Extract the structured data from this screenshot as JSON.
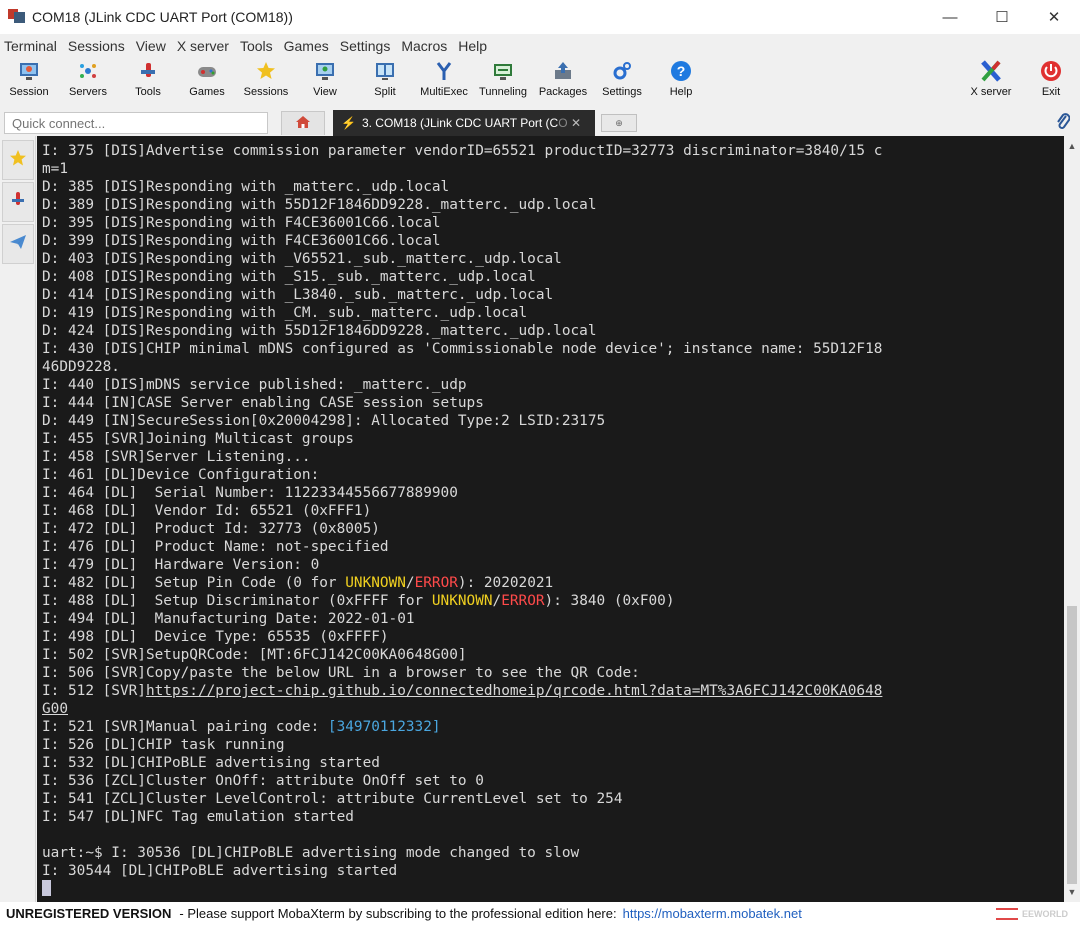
{
  "window": {
    "title": "COM18  (JLink CDC UART Port (COM18))",
    "minimize": "—",
    "maximize": "☐",
    "close": "✕"
  },
  "menu": [
    "Terminal",
    "Sessions",
    "View",
    "X server",
    "Tools",
    "Games",
    "Settings",
    "Macros",
    "Help"
  ],
  "toolbar": {
    "session": "Session",
    "servers": "Servers",
    "tools": "Tools",
    "games": "Games",
    "sessions": "Sessions",
    "view": "View",
    "split": "Split",
    "multiexec": "MultiExec",
    "tunneling": "Tunneling",
    "packages": "Packages",
    "settings": "Settings",
    "help": "Help",
    "xserver": "X server",
    "exit": "Exit"
  },
  "tabs": {
    "quick_connect_placeholder": "Quick connect...",
    "active_tab_label": "3. COM18  (JLink CDC UART Port (C",
    "active_tab_fade": "O",
    "close_glyph": "✕",
    "new_tab_glyph": "⊕"
  },
  "terminal": {
    "lines": [
      {
        "text": "I: 375 [DIS]Advertise commission parameter vendorID=65521 productID=32773 discriminator=3840/15 c"
      },
      {
        "text": "m=1"
      },
      {
        "text": "D: 385 [DIS]Responding with _matterc._udp.local"
      },
      {
        "text": "D: 389 [DIS]Responding with 55D12F1846DD9228._matterc._udp.local"
      },
      {
        "text": "D: 395 [DIS]Responding with F4CE36001C66.local"
      },
      {
        "text": "D: 399 [DIS]Responding with F4CE36001C66.local"
      },
      {
        "text": "D: 403 [DIS]Responding with _V65521._sub._matterc._udp.local"
      },
      {
        "text": "D: 408 [DIS]Responding with _S15._sub._matterc._udp.local"
      },
      {
        "text": "D: 414 [DIS]Responding with _L3840._sub._matterc._udp.local"
      },
      {
        "text": "D: 419 [DIS]Responding with _CM._sub._matterc._udp.local"
      },
      {
        "text": "D: 424 [DIS]Responding with 55D12F1846DD9228._matterc._udp.local"
      },
      {
        "text": "I: 430 [DIS]CHIP minimal mDNS configured as 'Commissionable node device'; instance name: 55D12F18"
      },
      {
        "text": "46DD9228."
      },
      {
        "text": "I: 440 [DIS]mDNS service published: _matterc._udp"
      },
      {
        "text": "I: 444 [IN]CASE Server enabling CASE session setups"
      },
      {
        "text": "D: 449 [IN]SecureSession[0x20004298]: Allocated Type:2 LSID:23175"
      },
      {
        "text": "I: 455 [SVR]Joining Multicast groups"
      },
      {
        "text": "I: 458 [SVR]Server Listening..."
      },
      {
        "text": "I: 461 [DL]Device Configuration:"
      },
      {
        "text": "I: 464 [DL]  Serial Number: 11223344556677889900"
      },
      {
        "text": "I: 468 [DL]  Vendor Id: 65521 (0xFFF1)"
      },
      {
        "text": "I: 472 [DL]  Product Id: 32773 (0x8005)"
      },
      {
        "text": "I: 476 [DL]  Product Name: not-specified"
      },
      {
        "text": "I: 479 [DL]  Hardware Version: 0"
      },
      {
        "pre": "I: 482 [DL]  Setup Pin Code (0 for ",
        "yellow": "UNKNOWN",
        "slash": "/",
        "red": "ERROR",
        "post": "): 20202021"
      },
      {
        "pre": "I: 488 [DL]  Setup Discriminator (0xFFFF for ",
        "yellow": "UNKNOWN",
        "slash": "/",
        "red": "ERROR",
        "post": "): 3840 (0xF00)"
      },
      {
        "text": "I: 494 [DL]  Manufacturing Date: 2022-01-01"
      },
      {
        "text": "I: 498 [DL]  Device Type: 65535 (0xFFFF)"
      },
      {
        "text": "I: 502 [SVR]SetupQRCode: [MT:6FCJ142C00KA0648G00]"
      },
      {
        "text": "I: 506 [SVR]Copy/paste the below URL in a browser to see the QR Code:"
      },
      {
        "pre": "I: 512 [SVR]",
        "link": "https://project-chip.github.io/connectedhomeip/qrcode.html?data=MT%3A6FCJ142C00KA0648"
      },
      {
        "link": "G00"
      },
      {
        "pre": "I: 521 [SVR]Manual pairing code: ",
        "cyan": "[34970112332]"
      },
      {
        "text": "I: 526 [DL]CHIP task running"
      },
      {
        "text": "I: 532 [DL]CHIPoBLE advertising started"
      },
      {
        "text": "I: 536 [ZCL]Cluster OnOff: attribute OnOff set to 0"
      },
      {
        "text": "I: 541 [ZCL]Cluster LevelControl: attribute CurrentLevel set to 254"
      },
      {
        "text": "I: 547 [DL]NFC Tag emulation started"
      },
      {
        "text": ""
      },
      {
        "text": "uart:~$ I: 30536 [DL]CHIPoBLE advertising mode changed to slow"
      },
      {
        "text": "I: 30544 [DL]CHIPoBLE advertising started"
      }
    ]
  },
  "status": {
    "unregistered": "UNREGISTERED VERSION",
    "message": "-  Please support MobaXterm by subscribing to the professional edition here:",
    "url": "https://mobaxterm.mobatek.net"
  },
  "watermark": {
    "text": "EEWORLD"
  }
}
